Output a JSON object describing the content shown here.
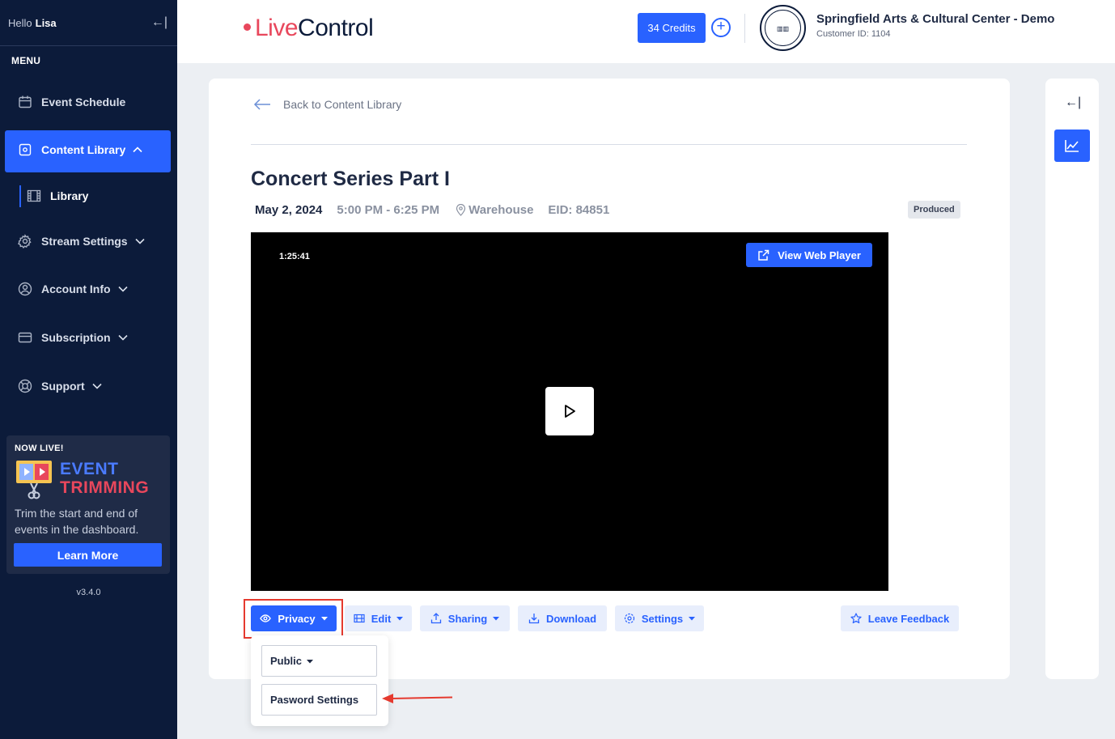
{
  "sidebar": {
    "hello": "Hello",
    "user": "Lisa",
    "collapse_glyph": "←|",
    "menu_label": "MENU",
    "items": [
      {
        "label": "Event Schedule",
        "icon": "calendar-icon"
      },
      {
        "label": "Content Library",
        "icon": "library-icon",
        "active": true
      },
      {
        "label": "Library",
        "icon": "film-icon",
        "sub": true
      },
      {
        "label": "Stream Settings",
        "icon": "gear-icon"
      },
      {
        "label": "Account Info",
        "icon": "user-icon"
      },
      {
        "label": "Subscription",
        "icon": "card-icon"
      },
      {
        "label": "Support",
        "icon": "lifebuoy-icon"
      }
    ],
    "promo": {
      "now_live": "NOW LIVE!",
      "title_line1": "EVENT",
      "title_line2": "TRIMMING",
      "text": "Trim the start and end of events in the dashboard.",
      "button": "Learn More"
    },
    "version": "v3.4.0"
  },
  "header": {
    "logo_live": "Live",
    "logo_control": "Control",
    "credits": "34 Credits",
    "org_name": "Springfield Arts & Cultural Center - Demo",
    "customer_id": "Customer ID: 1104"
  },
  "content": {
    "back_label": "Back to Content Library",
    "title": "Concert Series Part I",
    "date": "May 2, 2024",
    "time": "5:00 PM - 6:25 PM",
    "location": "Warehouse",
    "eid": "EID: 84851",
    "status": "Produced",
    "video": {
      "duration": "1:25:41",
      "web_player_label": "View Web Player"
    },
    "toolbar": {
      "privacy": "Privacy",
      "edit": "Edit",
      "sharing": "Sharing",
      "download": "Download",
      "settings": "Settings",
      "feedback": "Leave Feedback"
    },
    "privacy_menu": {
      "visibility": "Public",
      "password": "Pasword Settings"
    }
  },
  "right_panel": {
    "collapse_glyph": "←|"
  },
  "colors": {
    "accent": "#2962ff",
    "brand_red": "#e8475c",
    "sidebar_bg": "#0c1b3a",
    "highlight": "#e53a2f"
  }
}
